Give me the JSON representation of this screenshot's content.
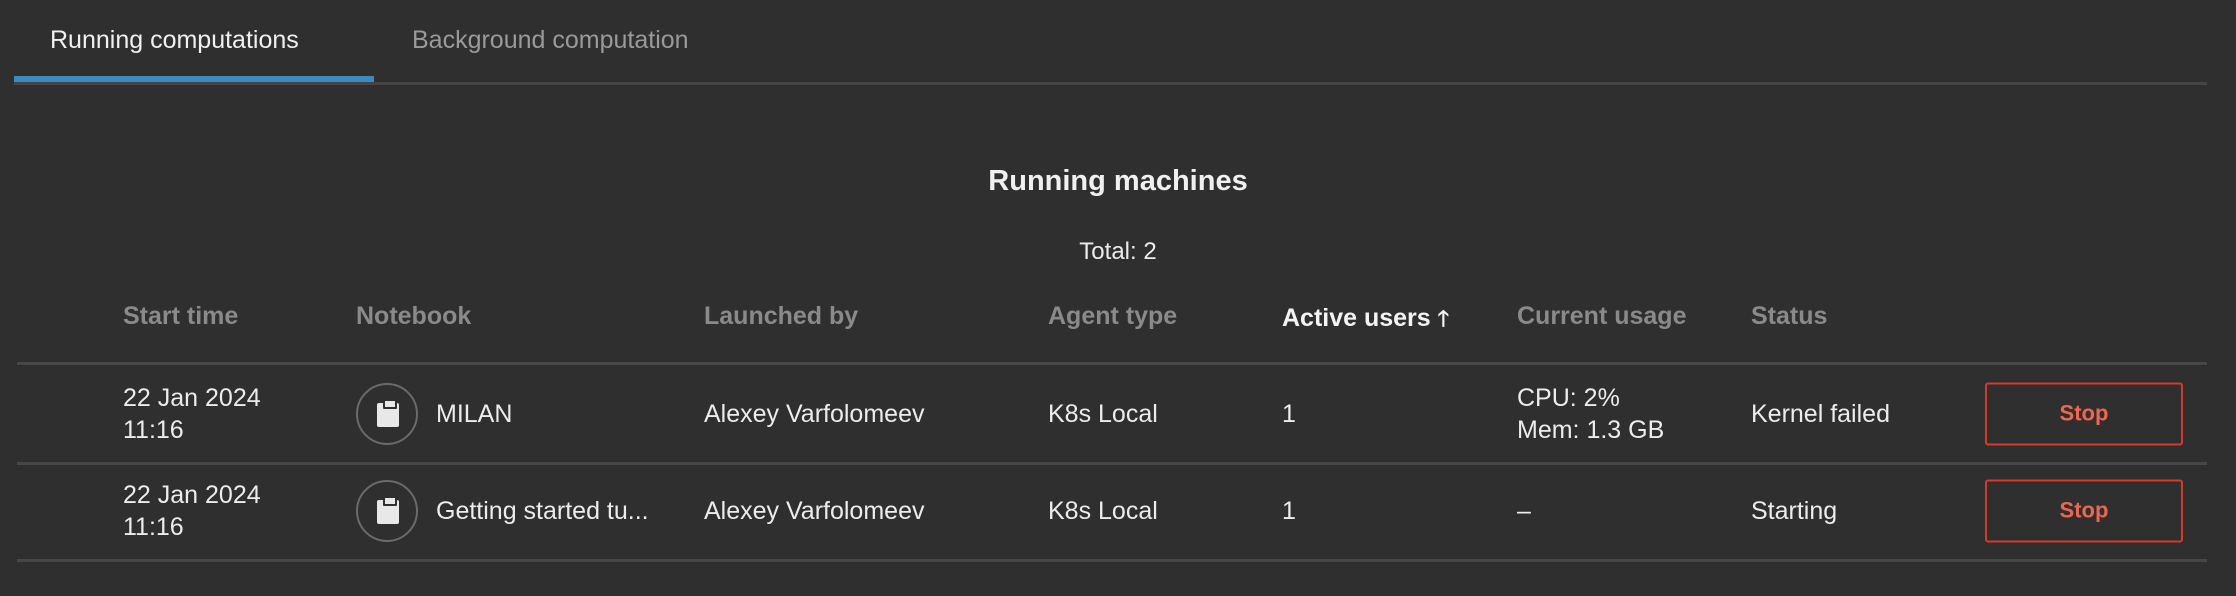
{
  "tabs": [
    {
      "label": "Running computations",
      "active": true
    },
    {
      "label": "Background computation",
      "active": false
    }
  ],
  "accent_color": "#3a8bc0",
  "title": "Running machines",
  "total": "Total: 2",
  "columns": [
    "Start time",
    "Notebook",
    "Launched by",
    "Agent type",
    "Active users",
    "Current usage",
    "Status"
  ],
  "sort_icon": "arrow-up-icon",
  "rows": [
    {
      "date": "22 Jan 2024",
      "time": "11:16",
      "notebook": "MILAN",
      "launched_by": "Alexey Varfolomeev",
      "agent_type": "K8s Local",
      "active_users": "1",
      "cpu": "CPU: 2%",
      "mem": "Mem: 1.3 GB",
      "status": "Kernel failed",
      "action": "Stop"
    },
    {
      "date": "22 Jan 2024",
      "time": "11:16",
      "notebook": "Getting started tu...",
      "launched_by": "Alexey Varfolomeev",
      "agent_type": "K8s Local",
      "active_users": "1",
      "cpu": "–",
      "mem": "",
      "status": "Starting",
      "action": "Stop"
    }
  ]
}
